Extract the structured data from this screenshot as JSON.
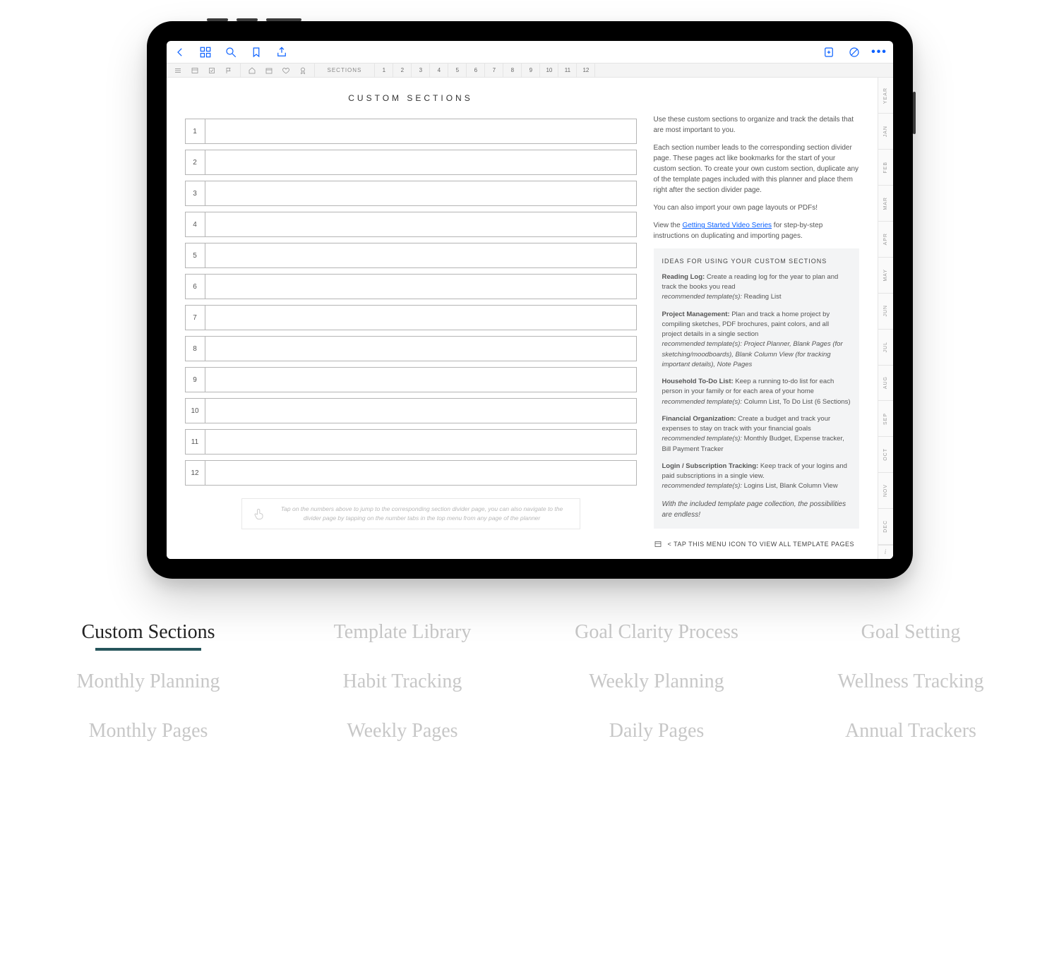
{
  "app_toolbar": {
    "back": "Back",
    "grid": "Thumbnails",
    "search": "Search",
    "bookmark": "Bookmark",
    "share": "Share",
    "addpage": "Add Page",
    "lasso": "Lasso",
    "more": "•••"
  },
  "subbar": {
    "sections_label": "SECTIONS",
    "numbers": [
      "1",
      "2",
      "3",
      "4",
      "5",
      "6",
      "7",
      "8",
      "9",
      "10",
      "11",
      "12"
    ]
  },
  "page": {
    "title": "CUSTOM SECTIONS",
    "rows": [
      "1",
      "2",
      "3",
      "4",
      "5",
      "6",
      "7",
      "8",
      "9",
      "10",
      "11",
      "12"
    ],
    "hint": "Tap on the numbers above to jump to the corresponding section divider page, you can also navigate to the divider page by tapping on the number tabs in the top menu from any page of the planner"
  },
  "side": {
    "p1": "Use these custom sections to organize and track the details that are most important to you.",
    "p2": "Each section number leads to the corresponding section divider page. These pages act like bookmarks for the start of your custom section. To create your own custom section, duplicate any of the template pages included with this planner and place them right after the section divider page.",
    "p3": "You can also import your own page layouts or PDFs!",
    "p4_pre": "View the ",
    "p4_link": "Getting Started Video Series",
    "p4_post": " for step-by-step instructions on duplicating and importing pages.",
    "ideas_heading": "IDEAS FOR USING YOUR CUSTOM SECTIONS",
    "ideas": [
      {
        "title": "Reading Log:",
        "body": " Create a reading log for the year to plan and track the books you read",
        "rec": "recommended template(s): ",
        "rec_body": "Reading List"
      },
      {
        "title": "Project Management:",
        "body": " Plan and track a home project by compiling sketches, PDF brochures, paint colors, and all project details in a single section",
        "rec": "recommended template(s): ",
        "rec_body": "Project Planner, Blank Pages (for sketching/moodboards), Blank Column View (for tracking important details), Note Pages"
      },
      {
        "title": "Household To-Do List:",
        "body": " Keep a running to-do list for each person in your family or for each area of your home",
        "rec": "recommended template(s): ",
        "rec_body": "Column List, To Do List (6 Sections)"
      },
      {
        "title": "Financial Organization:",
        "body": " Create a budget and track your expenses to stay on track with your financial goals",
        "rec": "recommended template(s): ",
        "rec_body": "Monthly Budget, Expense tracker, Bill Payment Tracker"
      },
      {
        "title": "Login / Subscription Tracking:",
        "body": " Keep track of your logins and paid subscriptions in a single view.",
        "rec": "recommended template(s): ",
        "rec_body": "Logins List, Blank Column View"
      }
    ],
    "closing": "With the included template page collection, the possibilities are endless!",
    "tap_menu": "<   TAP THIS MENU ICON TO VIEW ALL TEMPLATE PAGES"
  },
  "months": [
    "YEAR",
    "JAN",
    "FEB",
    "MAR",
    "APR",
    "MAY",
    "JUN",
    "JUL",
    "AUG",
    "SEP",
    "OCT",
    "NOV",
    "DEC"
  ],
  "features": {
    "row1": [
      "Custom Sections",
      "Template Library",
      "Goal Clarity Process",
      "Goal Setting"
    ],
    "row2": [
      "Monthly Planning",
      "Habit Tracking",
      "Weekly Planning",
      "Wellness Tracking"
    ],
    "row3": [
      "Monthly Pages",
      "Weekly Pages",
      "Daily Pages",
      "Annual Trackers"
    ],
    "active": "Custom Sections"
  }
}
